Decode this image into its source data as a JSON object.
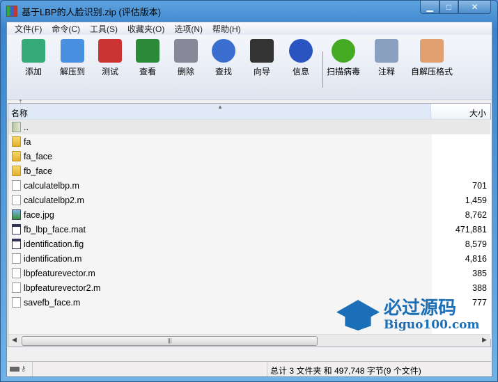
{
  "window": {
    "title": "基于LBP的人脸识别.zip (评估版本)"
  },
  "menu": [
    "文件(F)",
    "命令(C)",
    "工具(S)",
    "收藏夹(O)",
    "选项(N)",
    "帮助(H)"
  ],
  "toolbar": [
    {
      "label": "添加",
      "icon": "add-archive-icon",
      "color": "#3a7"
    },
    {
      "label": "解压到",
      "icon": "extract-folder-icon",
      "color": "#4a90e0"
    },
    {
      "label": "测试",
      "icon": "test-clipboard-icon",
      "color": "#c33"
    },
    {
      "label": "查看",
      "icon": "view-book-icon",
      "color": "#2a8a3a"
    },
    {
      "label": "删除",
      "icon": "delete-trash-icon",
      "color": "#889"
    },
    {
      "label": "查找",
      "icon": "find-magnifier-icon",
      "color": "#3a6fd0"
    },
    {
      "label": "向导",
      "icon": "wizard-wand-icon",
      "color": "#333"
    },
    {
      "label": "信息",
      "icon": "info-icon",
      "color": "#2a55c0"
    },
    {
      "label": "扫描病毒",
      "icon": "virus-scan-icon",
      "color": "#4a2"
    },
    {
      "label": "注释",
      "icon": "comment-icon",
      "color": "#8aa0c0"
    },
    {
      "label": "自解压格式",
      "icon": "sfx-box-icon",
      "color": "#e0a070"
    }
  ],
  "columns": {
    "name": "名称",
    "size": "大小"
  },
  "files": [
    {
      "name": "..",
      "size": "",
      "type": "upf"
    },
    {
      "name": "fa",
      "size": "",
      "type": "folder"
    },
    {
      "name": "fa_face",
      "size": "",
      "type": "folder"
    },
    {
      "name": "fb_face",
      "size": "",
      "type": "folder"
    },
    {
      "name": "calculatelbp.m",
      "size": "701",
      "type": "doc"
    },
    {
      "name": "calculatelbp2.m",
      "size": "1,459",
      "type": "doc"
    },
    {
      "name": "face.jpg",
      "size": "8,762",
      "type": "img"
    },
    {
      "name": "fb_lbp_face.mat",
      "size": "471,881",
      "type": "mat"
    },
    {
      "name": "identification.fig",
      "size": "8,579",
      "type": "mat"
    },
    {
      "name": "identification.m",
      "size": "4,816",
      "type": "doc"
    },
    {
      "name": "lbpfeaturevector.m",
      "size": "385",
      "type": "doc"
    },
    {
      "name": "lbpfeaturevector2.m",
      "size": "388",
      "type": "doc"
    },
    {
      "name": "savefb_face.m",
      "size": "777",
      "type": "doc"
    }
  ],
  "status": {
    "summary": "总计 3 文件夹 和 497,748 字节(9 个文件)"
  },
  "watermark": {
    "title": "必过源码",
    "url": "Biguo100.com"
  }
}
